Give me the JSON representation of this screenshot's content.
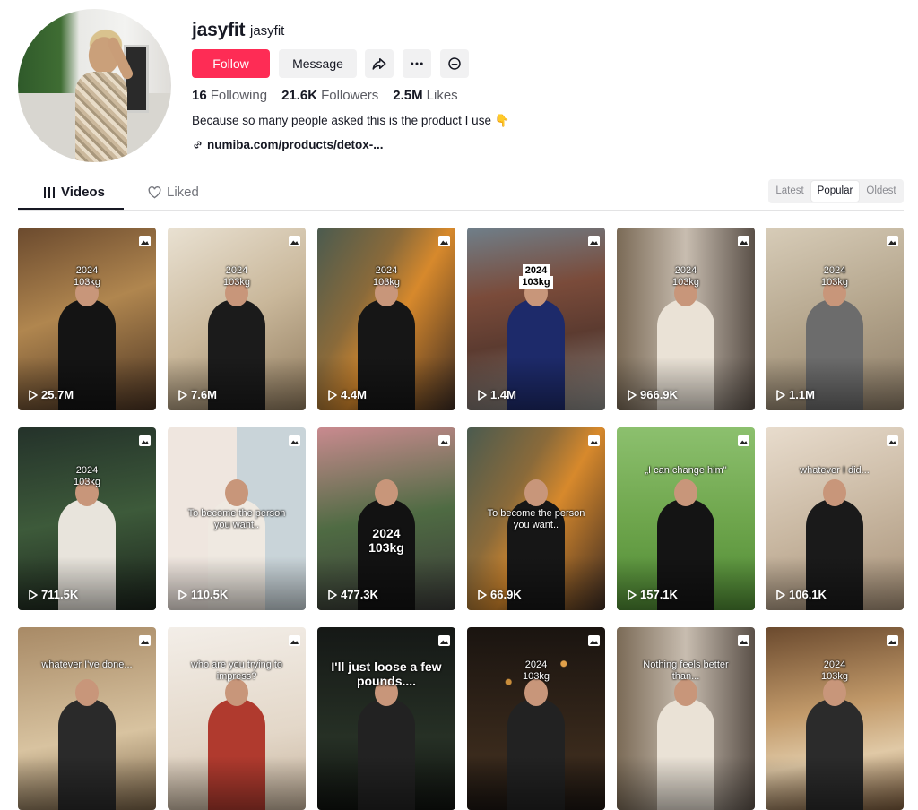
{
  "profile": {
    "username": "jasyfit",
    "nickname": "jasyfit",
    "follow_label": "Follow",
    "message_label": "Message",
    "following_count": "16",
    "following_label": "Following",
    "followers_count": "21.6K",
    "followers_label": "Followers",
    "likes_count": "2.5M",
    "likes_label": "Likes",
    "bio": "Because so many people asked this is the product I use 👇",
    "link": "numiba.com/products/detox-..."
  },
  "tabs": {
    "videos": "Videos",
    "liked": "Liked"
  },
  "sort": {
    "options": [
      "Latest",
      "Popular",
      "Oldest"
    ],
    "selected": "Popular"
  },
  "videos": [
    {
      "views": "25.7M",
      "caption": "2024\n103kg",
      "scene": "warm-cave"
    },
    {
      "views": "7.6M",
      "caption": "2024\n103kg",
      "scene": "mirror-selfie"
    },
    {
      "views": "4.4M",
      "caption": "2024\n103kg",
      "scene": "graffiti-street"
    },
    {
      "views": "1.4M",
      "caption": "2024\n103kg",
      "scene": "brick-street",
      "boxed": true
    },
    {
      "views": "966.9K",
      "caption": "2024\n103kg",
      "scene": "elevator"
    },
    {
      "views": "1.1M",
      "caption": "2024\n103kg",
      "scene": "mirror-room"
    },
    {
      "views": "711.5K",
      "caption": "2024\n103kg",
      "scene": "night-garden"
    },
    {
      "views": "110.5K",
      "caption": "To become the person\nyou want..",
      "scene": "collage"
    },
    {
      "views": "477.3K",
      "caption": "2024\n103kg",
      "scene": "flower-cafe",
      "big": true
    },
    {
      "views": "66.9K",
      "caption": "To become the person\nyou want..",
      "scene": "graffiti-street"
    },
    {
      "views": "157.1K",
      "caption": "„I can change him\"",
      "scene": "green-lawn"
    },
    {
      "views": "106.1K",
      "caption": "whatever I did...",
      "scene": "store"
    },
    {
      "views": "",
      "caption": "whatever I've done...",
      "scene": "warm-hall"
    },
    {
      "views": "",
      "caption": "who are you trying to\nimpress?",
      "scene": "bright-room"
    },
    {
      "views": "",
      "caption": "I'll just loose a few\npounds....",
      "scene": "dark-night",
      "big": true
    },
    {
      "views": "",
      "caption": "2024\n103kg",
      "scene": "night-lights"
    },
    {
      "views": "",
      "caption": "Nothing feels better\nthan...",
      "scene": "elevator"
    },
    {
      "views": "",
      "caption": "2024\n103kg",
      "scene": "statue"
    }
  ]
}
